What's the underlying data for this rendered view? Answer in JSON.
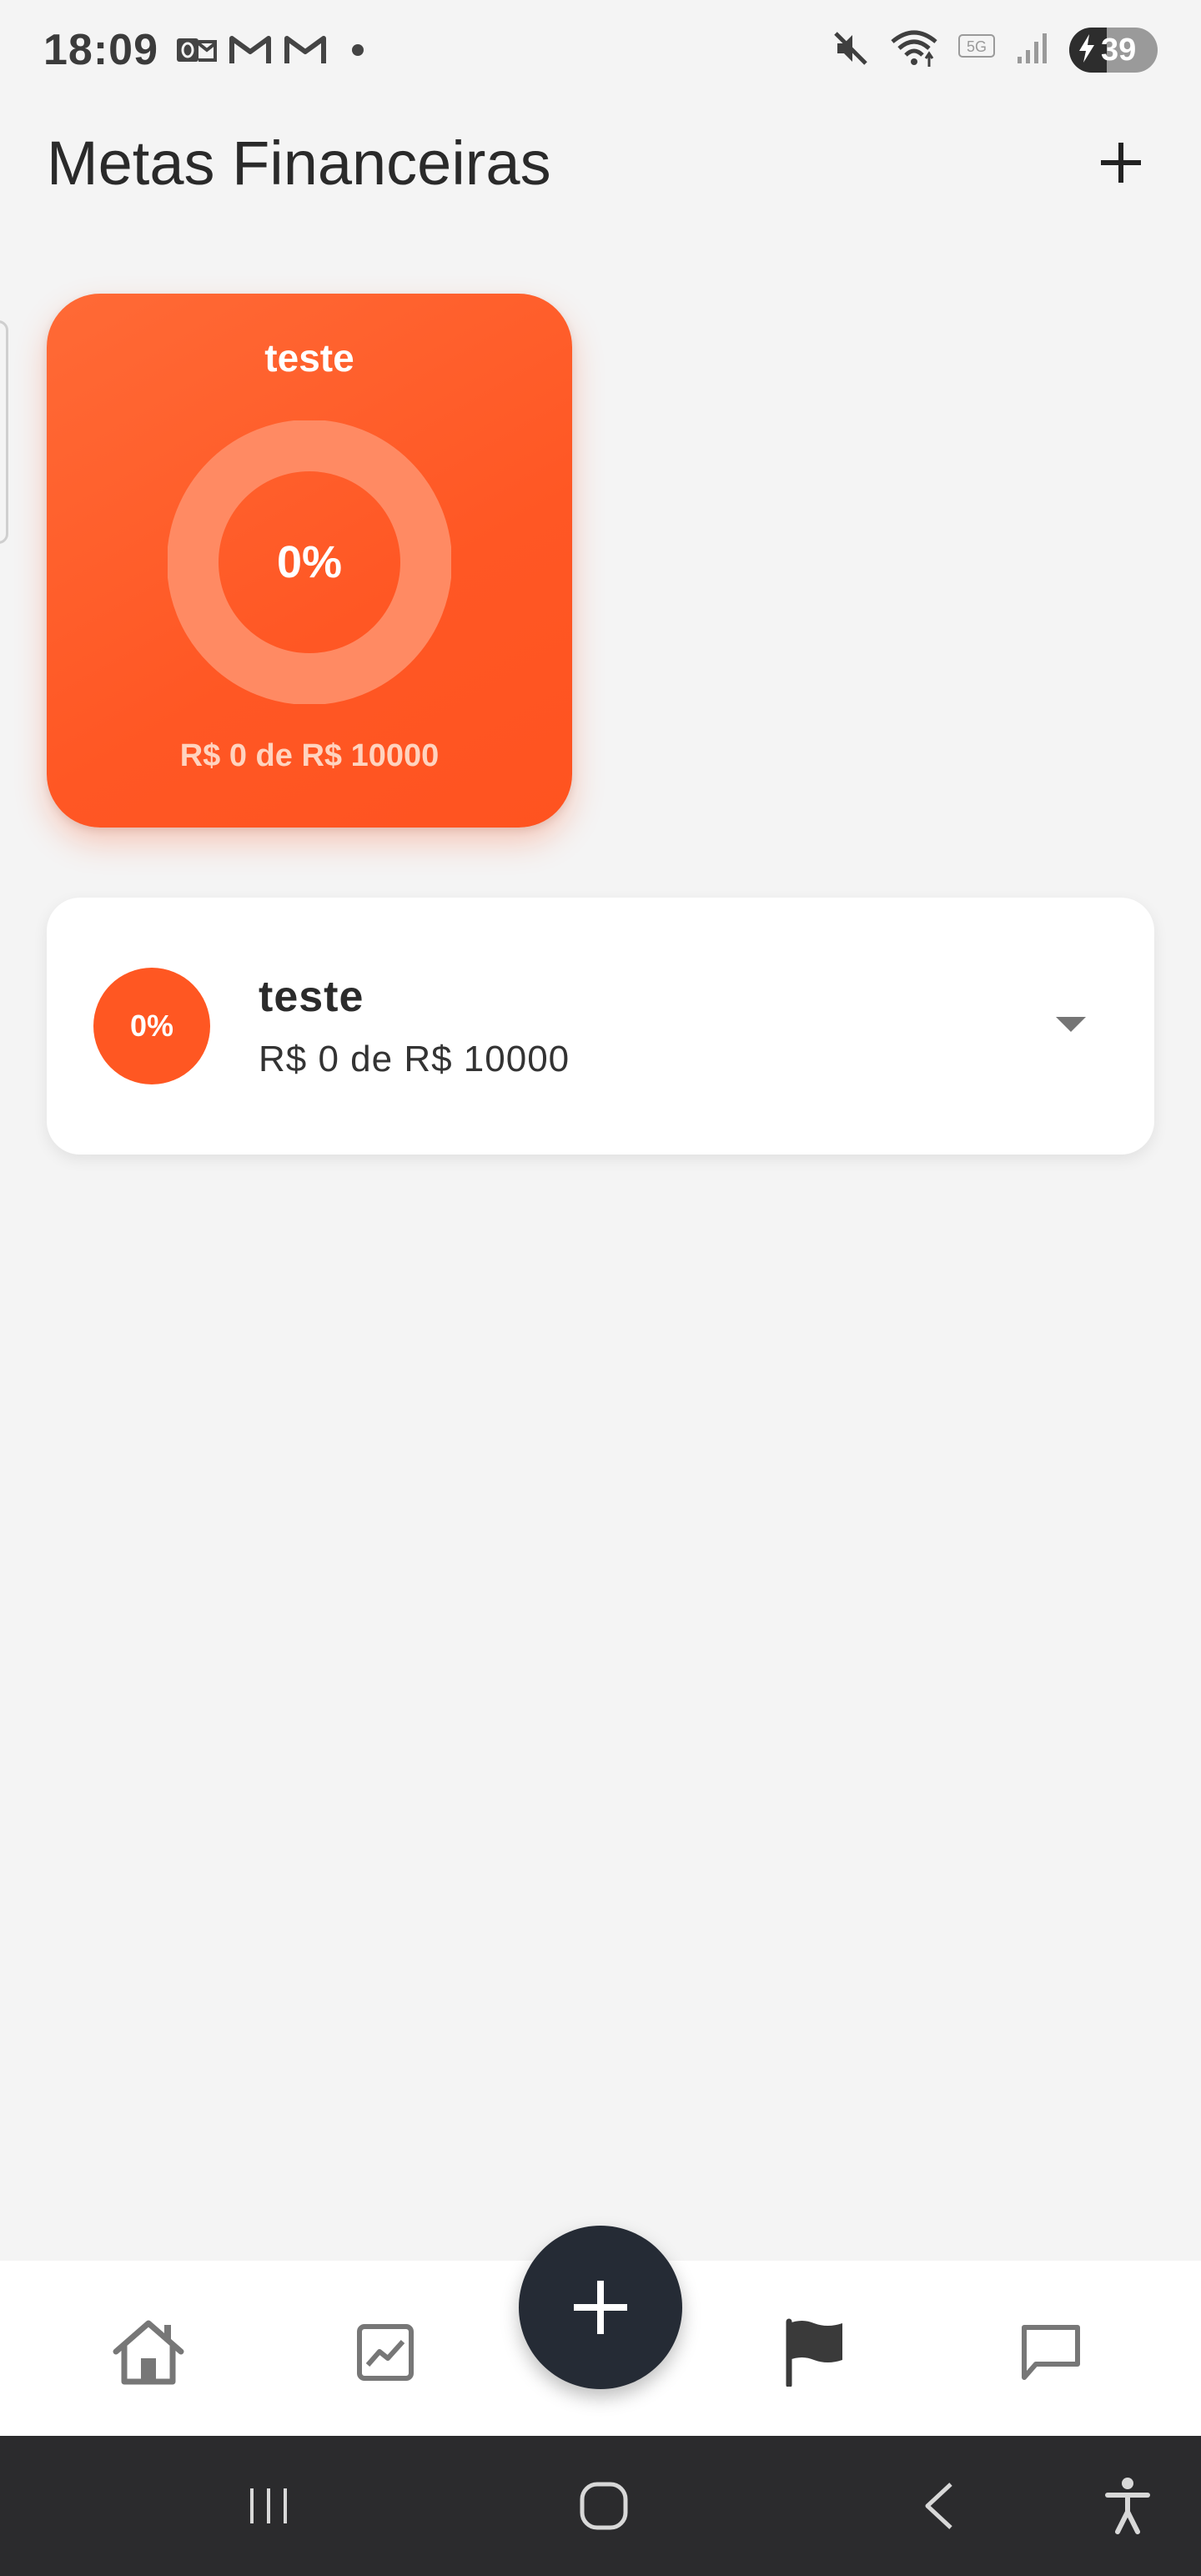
{
  "status_bar": {
    "time": "18:09",
    "left_icons": [
      "outlook-icon",
      "gmail-icon",
      "gmail-icon",
      "notification-dot"
    ],
    "right_icons": [
      "mute-icon",
      "wifi-icon",
      "5g-icon",
      "signal-icon"
    ],
    "network_label": "5G",
    "battery_percent": "39"
  },
  "header": {
    "title": "Metas Financeiras",
    "add_icon": "plus-icon"
  },
  "goal_card": {
    "title": "teste",
    "percent_label": "0%",
    "progress_fraction": 0,
    "amount_text": "R$ 0 de R$ 10000",
    "colors": {
      "start": "#ff6a36",
      "end": "#ff5320",
      "ring_track": "#ff8a63"
    }
  },
  "goal_list": [
    {
      "badge": "0%",
      "title": "teste",
      "amount_text": "R$ 0 de R$ 10000",
      "expand_icon": "caret-down-icon"
    }
  ],
  "bottom_nav": {
    "items": [
      "home-icon",
      "chart-icon",
      "add-icon",
      "flag-icon",
      "chat-icon"
    ],
    "active": "flag-icon",
    "fab_color": "#252b35"
  },
  "system_nav": {
    "items": [
      "recent-apps-icon",
      "home-circle-icon",
      "back-icon",
      "accessibility-icon"
    ]
  },
  "colors": {
    "accent": "#ff5722",
    "background": "#f4f4f4"
  }
}
